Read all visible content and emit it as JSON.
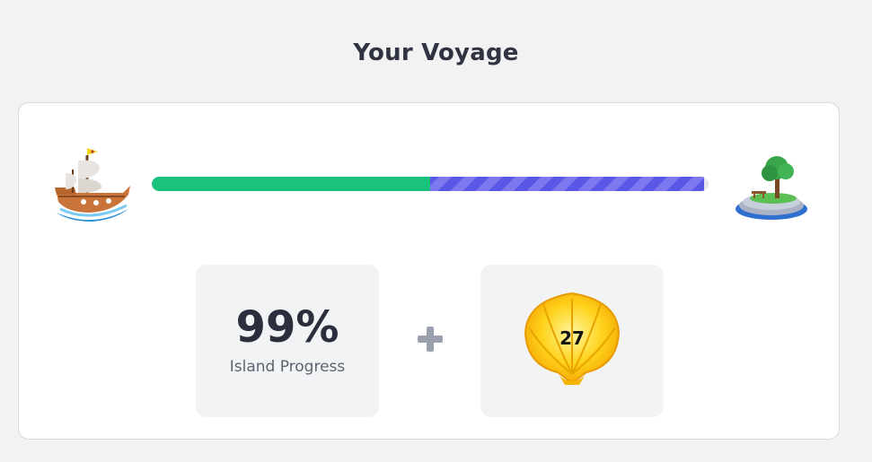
{
  "header": {
    "title": "Your Voyage"
  },
  "progress": {
    "completed_fraction": 0.5,
    "in_progress_fraction": 0.492,
    "colors": {
      "completed": "#19c37d",
      "in_progress": "#5a57e6",
      "track": "#e4e4ea"
    },
    "start_icon": "ship-icon",
    "end_icon": "island-icon"
  },
  "stats": {
    "island_progress_value": "99%",
    "island_progress_label": "Island Progress",
    "separator_icon": "plus-icon",
    "shell_icon": "shell-icon",
    "shell_count": "27"
  }
}
